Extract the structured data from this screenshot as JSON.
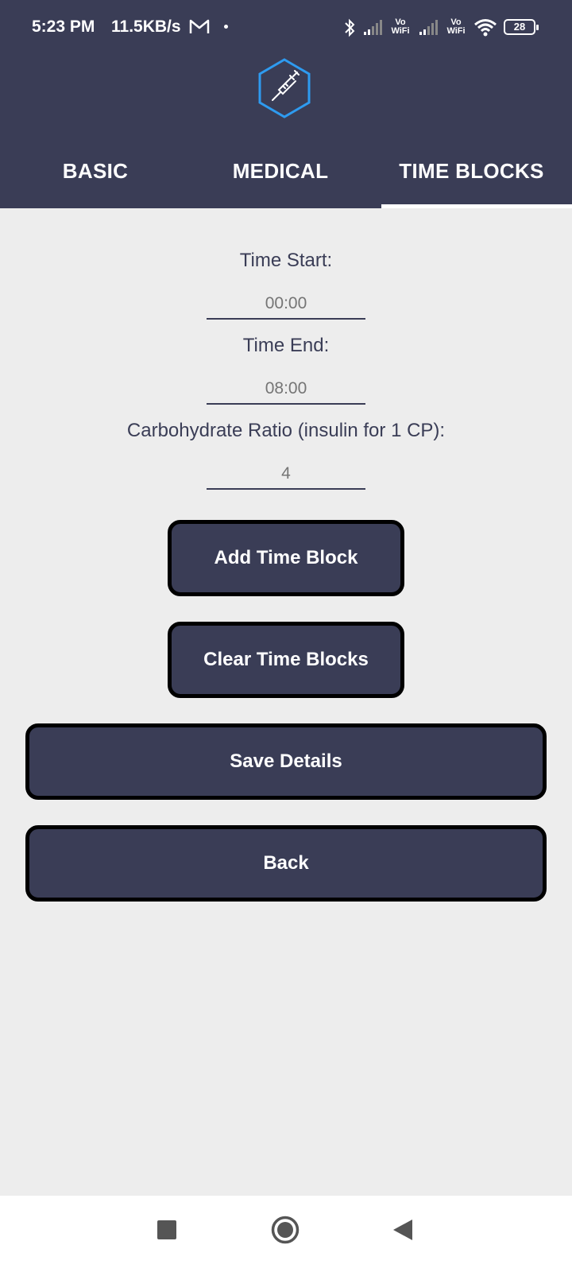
{
  "status_bar": {
    "time": "5:23 PM",
    "speed": "11.5KB/s",
    "vowifi_1": "Vo\nWiFi",
    "vowifi_2": "Vo\nWiFi",
    "battery": "28"
  },
  "header": {
    "logo_icon": "syringe-hexagon-icon",
    "accent": "#2e9bf0",
    "background": "#3a3d56"
  },
  "tabs": [
    {
      "label": "BASIC",
      "selected": false
    },
    {
      "label": "MEDICAL",
      "selected": false
    },
    {
      "label": "TIME BLOCKS",
      "selected": true
    }
  ],
  "form": {
    "time_start_label": "Time Start:",
    "time_start_placeholder": "00:00",
    "time_end_label": "Time End:",
    "time_end_placeholder": "08:00",
    "carb_ratio_label": "Carbohydrate Ratio (insulin for 1 CP):",
    "carb_ratio_placeholder": "4"
  },
  "buttons": {
    "add_time_block": "Add Time Block",
    "clear_time_blocks": "Clear Time Blocks",
    "save_details": "Save Details",
    "back": "Back"
  },
  "nav_bar": {
    "recents_icon": "square-icon",
    "home_icon": "circle-icon",
    "back_icon": "triangle-back-icon"
  }
}
